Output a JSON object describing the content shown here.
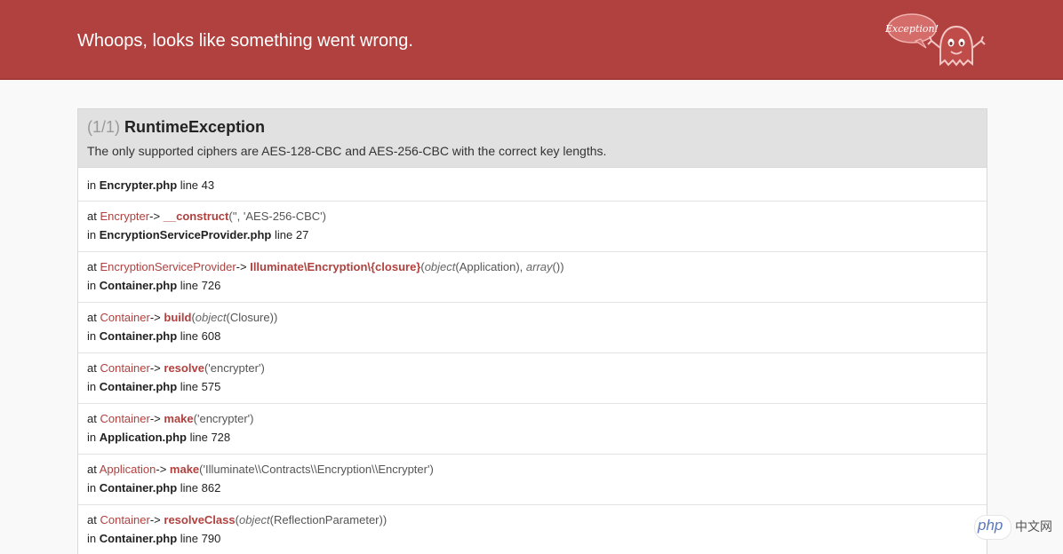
{
  "header": {
    "title": "Whoops, looks like something went wrong.",
    "logo_text": "Exception!",
    "color": "#b0413e"
  },
  "exception": {
    "count": "(1/1)",
    "name": "RuntimeException",
    "message": "The only supported ciphers are AES-128-CBC and AES-256-CBC with the correct key lengths."
  },
  "trace": {
    "first": {
      "prefix": "in",
      "file": "Encrypter.php",
      "line": "line 43"
    },
    "rows": [
      {
        "cls": "Encrypter",
        "arrow": "->",
        "fn": "__construct",
        "args_open": "(",
        "args": "'', 'AES-256-CBC'",
        "args_close": ")",
        "file": "EncryptionServiceProvider.php",
        "line": "line 27"
      },
      {
        "cls": "EncryptionServiceProvider",
        "arrow": "->",
        "fn": "Illuminate\\Encryption\\{closure}",
        "file": "Container.php",
        "line": "line 726"
      },
      {
        "cls": "Container",
        "arrow": "->",
        "fn": "build",
        "file": "Container.php",
        "line": "line 608"
      },
      {
        "cls": "Container",
        "arrow": "->",
        "fn": "resolve",
        "args": "'encrypter'",
        "file": "Container.php",
        "line": "line 575"
      },
      {
        "cls": "Container",
        "arrow": "->",
        "fn": "make",
        "args": "'encrypter'",
        "file": "Application.php",
        "line": "line 728"
      },
      {
        "cls": "Application",
        "arrow": "->",
        "fn": "make",
        "args": "'Illuminate\\\\Contracts\\\\Encryption\\\\Encrypter'",
        "file": "Container.php",
        "line": "line 862"
      },
      {
        "cls": "Container",
        "arrow": "->",
        "fn": "resolveClass",
        "file": "Container.php",
        "line": "line 790"
      }
    ],
    "labels": {
      "at": "at",
      "in": "in"
    },
    "row2_args": {
      "kw1": "object",
      "arg1": "(Application), ",
      "kw2": "array",
      "arg2": "()"
    },
    "row3_args": {
      "kw1": "object",
      "arg1": "(Closure)"
    },
    "row7_args": {
      "kw1": "object",
      "arg1": "(ReflectionParameter)"
    }
  },
  "watermark": {
    "brand": "php",
    "site": "中文网"
  }
}
